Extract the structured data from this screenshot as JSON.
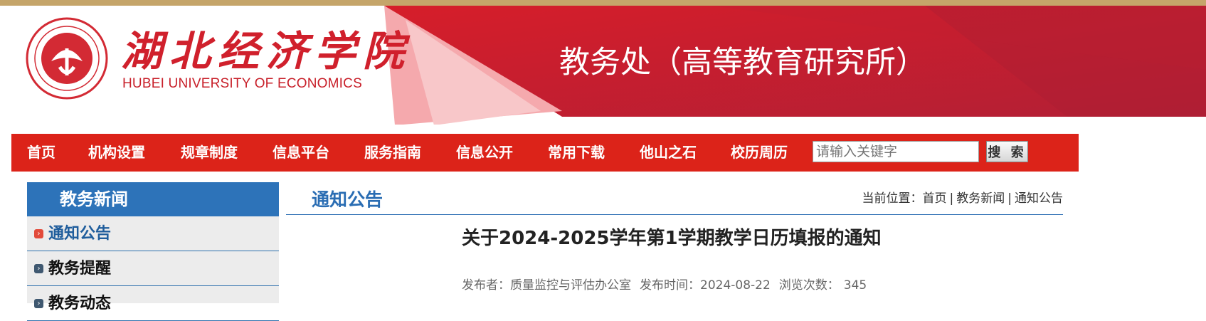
{
  "header": {
    "logo_cn": "湖北经济学院",
    "logo_en": "HUBEI UNIVERSITY OF ECONOMICS",
    "site_title": "教务处（高等教育研究所）"
  },
  "nav": {
    "items": [
      "首页",
      "机构设置",
      "规章制度",
      "信息平台",
      "服务指南",
      "信息公开",
      "常用下载",
      "他山之石",
      "校历周历"
    ],
    "search_placeholder": "请输入关键字",
    "search_button": "搜 索"
  },
  "sidebar": {
    "heading": "教务新闻",
    "items": [
      {
        "label": "通知公告",
        "active": true
      },
      {
        "label": "教务提醒",
        "active": false
      },
      {
        "label": "教务动态",
        "active": false
      }
    ]
  },
  "main": {
    "section_title": "通知公告",
    "breadcrumb_prefix": "当前位置：",
    "breadcrumb": [
      "首页",
      "教务新闻",
      "通知公告"
    ],
    "article_title": "关于2024-2025学年第1学期教学日历填报的通知",
    "publisher_label": "发布者：质量监控与评估办公室",
    "date_label": "发布时间：2024-08-22",
    "views_label": "浏览次数：",
    "views": "345"
  },
  "colors": {
    "nav_red": "#dc2319",
    "sidebar_blue": "#2d73b9",
    "accent_blue": "#2a6db3",
    "gold": "#c5a56a"
  }
}
